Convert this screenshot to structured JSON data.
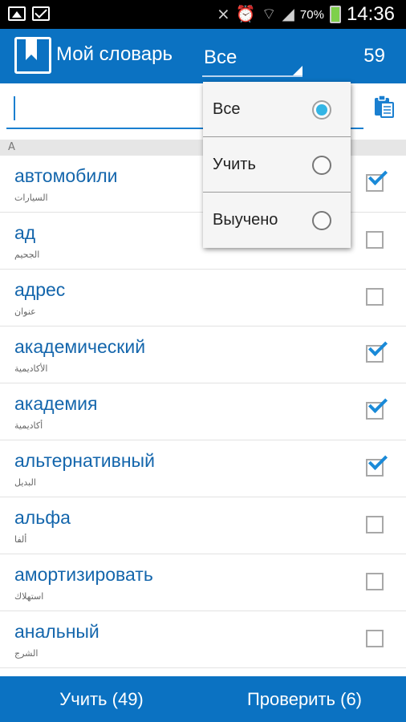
{
  "status_bar": {
    "battery": "70%",
    "time": "14:36",
    "icons": [
      "gallery-icon",
      "mail-icon",
      "mute-icon",
      "alarm-icon",
      "wifi-icon",
      "signal-icon",
      "battery-icon"
    ]
  },
  "header": {
    "title": "Мой словарь",
    "filter_selected": "Все",
    "count": "59"
  },
  "dropdown": {
    "options": [
      {
        "label": "Все",
        "selected": true
      },
      {
        "label": "Учить",
        "selected": false
      },
      {
        "label": "Выучено",
        "selected": false
      }
    ]
  },
  "search": {
    "value": "",
    "placeholder": ""
  },
  "section_letter": "А",
  "words": [
    {
      "word": "автомобили",
      "translation": "السيارات",
      "checked": true
    },
    {
      "word": "ад",
      "translation": "الجحيم",
      "checked": false
    },
    {
      "word": "адрес",
      "translation": "عنوان",
      "checked": false
    },
    {
      "word": "академический",
      "translation": "الأكاديمية",
      "checked": true
    },
    {
      "word": "академия",
      "translation": "أكاديمية",
      "checked": true
    },
    {
      "word": "альтернативный",
      "translation": "البديل",
      "checked": true
    },
    {
      "word": "альфа",
      "translation": "ألفا",
      "checked": false
    },
    {
      "word": "амортизировать",
      "translation": "استهلاك",
      "checked": false
    },
    {
      "word": "анальный",
      "translation": "الشرج",
      "checked": false
    }
  ],
  "bottom": {
    "learn_label": "Учить (49)",
    "check_label": "Проверить (6)"
  },
  "colors": {
    "primary": "#0b72c2",
    "word_text": "#1466ac",
    "check_accent": "#1a8ad8",
    "radio_accent": "#33b5e5"
  }
}
